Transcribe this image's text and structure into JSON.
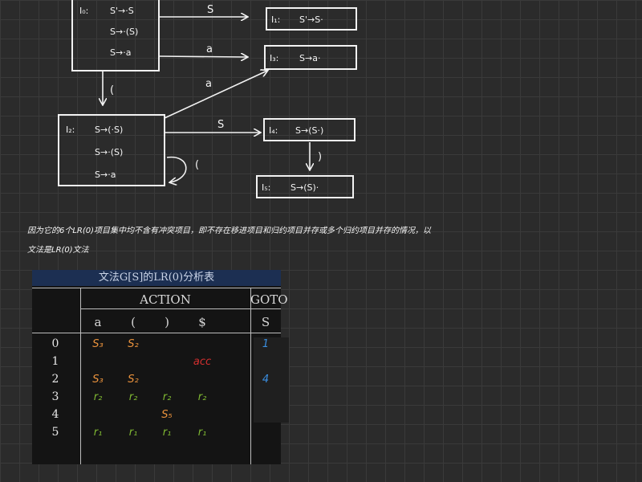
{
  "states": {
    "i0": {
      "name": "I₀:",
      "items": [
        "S'→·S",
        "S→·(S)",
        "S→·a"
      ]
    },
    "i1": {
      "name": "I₁:",
      "item": "S'→S·"
    },
    "i2": {
      "name": "I₂:",
      "items": [
        "S→(·S)",
        "S→·(S)",
        "S→·a"
      ]
    },
    "i3": {
      "name": "I₃:",
      "item": "S→a·"
    },
    "i4": {
      "name": "I₄:",
      "item": "S→(S·)"
    },
    "i5": {
      "name": "I₅:",
      "item": "S→(S)·"
    }
  },
  "transitions": {
    "i0_i1": "S",
    "i0_i3": "a",
    "i0_i2": "(",
    "i2_i3": "a",
    "i2_i4": "S",
    "i2_self": "(",
    "i4_i5": ")"
  },
  "note": {
    "line1": "因为它的6个LR(0)项目集中均不含有冲突项目，即不存在移进项目和归约项目并存或多个归约项目并存的情况，以",
    "line2": "文法是LR(0)文法"
  },
  "table": {
    "title": "文法G[S]的LR(0)分析表",
    "action_header": "ACTION",
    "goto_header": "GOTO",
    "terminals": [
      "a",
      "(",
      ")",
      "$"
    ],
    "nonterminals": [
      "S"
    ],
    "rows": [
      {
        "state": "0",
        "a": "S₃",
        "lp": "S₂",
        "rp": "",
        "end": "",
        "goto": "1"
      },
      {
        "state": "1",
        "a": "",
        "lp": "",
        "rp": "",
        "end": "acc",
        "goto": ""
      },
      {
        "state": "2",
        "a": "S₃",
        "lp": "S₂",
        "rp": "",
        "end": "",
        "goto": "4"
      },
      {
        "state": "3",
        "a": "r₂",
        "lp": "r₂",
        "rp": "r₂",
        "end": "r₂",
        "goto": ""
      },
      {
        "state": "4",
        "a": "",
        "lp": "",
        "rp": "S₅",
        "end": "",
        "goto": ""
      },
      {
        "state": "5",
        "a": "r₁",
        "lp": "r₁",
        "rp": "r₁",
        "end": "r₁",
        "goto": ""
      }
    ]
  },
  "colors": {
    "shift": "#e8913c",
    "reduce": "#7fb832",
    "accept": "#d32f2f",
    "goto": "#3a8ee0"
  }
}
